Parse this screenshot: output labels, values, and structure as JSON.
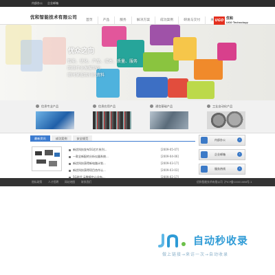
{
  "topbar": {
    "link1": "内部办公",
    "link2": "企业邮箱"
  },
  "header": {
    "company": "优和智能技术有限公司",
    "nav": [
      "首页",
      "产品",
      "服务",
      "解决方案",
      "成功案例",
      "研发与交付",
      "关于优和"
    ],
    "brand_badge": "UGO",
    "brand_cn": "优和",
    "brand_en": "UGO Technology"
  },
  "banner": {
    "title": "优众之向",
    "slogan_1": "智能、优化、产品、成本、质量、服务",
    "slogan_2": "网络行业发展动向",
    "slogan_3": "随时掌握我们的资料"
  },
  "features": [
    {
      "label": "信息专业产品"
    },
    {
      "label": "信息应用产品"
    },
    {
      "label": "通信基础产品"
    },
    {
      "label": "工业自动化产品"
    }
  ],
  "news": {
    "tabs": [
      "最新资讯",
      "成功案例",
      "安全规范"
    ],
    "rows": [
      {
        "title": "新优科技发布5G芯片系列...",
        "date": "[2009-05-07]"
      },
      {
        "title": "一款全新配的分析仪器系统...",
        "date": "[2009-04-06]"
      },
      {
        "title": "新优科技获得新电路计划...",
        "date": "[2009-03-17]"
      },
      {
        "title": "新优科技获得项目合作认...",
        "date": "[2009-03-03]"
      },
      {
        "title": "5G时代 云数据中心全布...",
        "date": "[2009-02-17]"
      }
    ]
  },
  "side": [
    {
      "label": "内部办公"
    },
    {
      "label": "企业邮箱"
    },
    {
      "label": "服务热线"
    }
  ],
  "footer": {
    "links": [
      "隐私政策",
      "人才招聘",
      "网站地图",
      "联系我们"
    ],
    "copyright": "优和智能技术有限公司",
    "icp": "沪ICP备10001086号-1"
  },
  "watermark": {
    "main": "自动秒收录",
    "sub": "做上链接→来访一次→自动收录"
  },
  "colors": {
    "accent": "#3b7bd0",
    "brand_red": "#e4301f",
    "watermark": "#2e9bd6"
  }
}
